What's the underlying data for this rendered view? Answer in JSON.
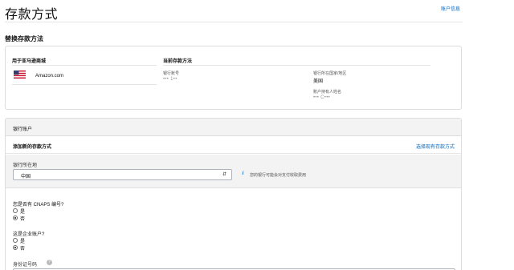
{
  "header": {
    "title": "存款方式",
    "account_link": "账户信息"
  },
  "replace_section": {
    "title": "替换存款方法",
    "col_marketplace": "用于亚马逊商城",
    "col_current": "当前存款方法",
    "marketplace": {
      "flag_icon": "us-flag-icon",
      "name": "Amazon.com"
    },
    "current": {
      "account_number_label": "银行账号",
      "account_number_value": "••• 1••",
      "bank_country_label": "银行所在国家/地区",
      "bank_country_value": "美国",
      "holder_label": "账户持有人姓名",
      "holder_value": "••• C•••"
    }
  },
  "bank_section": {
    "header": "银行账户",
    "add_title": "添加新的存款方式",
    "choose_link": "选择现有存款方式",
    "country_label": "银行所在地",
    "country_value": "中国",
    "info_icon": "info-icon",
    "info_text": "您的银行可能会对支付收取费用",
    "cnaps_question": "您是否有 CNAPS 编号?",
    "cnaps_options": [
      {
        "label": "是",
        "checked": false
      },
      {
        "label": "否",
        "checked": true
      }
    ],
    "business_question": "这是企业账户?",
    "business_options": [
      {
        "label": "是",
        "checked": false
      },
      {
        "label": "否",
        "checked": true
      }
    ],
    "id_label": "身份证号码",
    "help_icon": "help-icon",
    "id_value": ""
  }
}
